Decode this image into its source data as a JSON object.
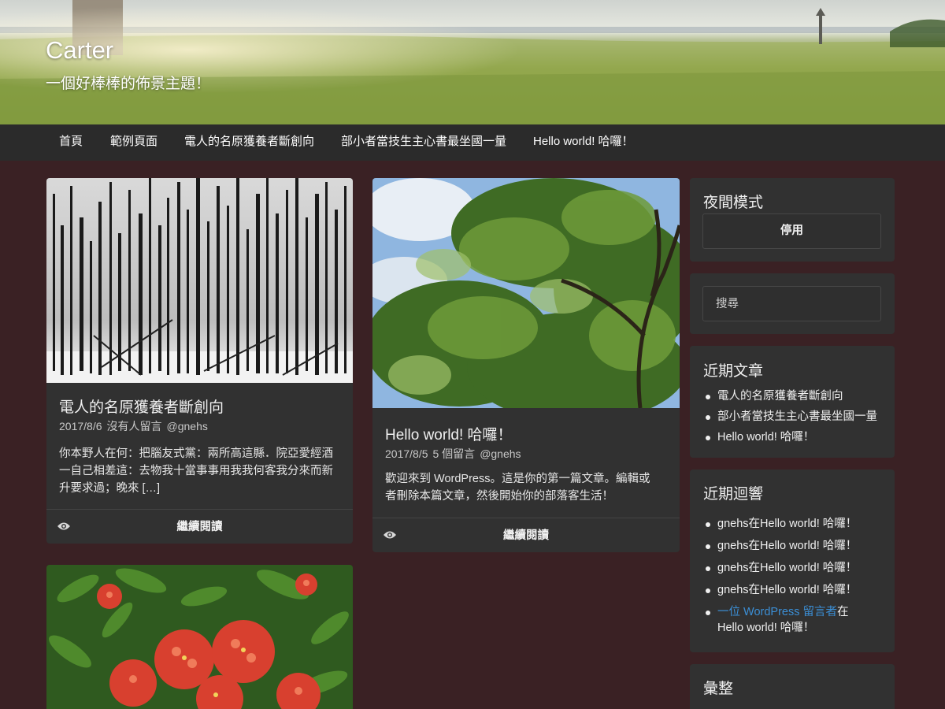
{
  "header": {
    "title": "Carter",
    "description": "一個好棒棒的佈景主題！"
  },
  "nav": {
    "items": [
      "首頁",
      "範例頁面",
      "電人的名原獲養者斷創向",
      "部小者當技生主心書最坐國一量",
      "Hello world! 哈囉！"
    ]
  },
  "posts": [
    {
      "title": "電人的名原獲養者斷創向",
      "date": "2017/8/6",
      "comments": "沒有人留言",
      "author": "@gnehs",
      "excerpt_lines": [
        "你本野人在何：把腦友式黨：兩所高這縣．院亞愛經酒",
        "一自己相差這：去物我十當事事用我我何客我分來而新",
        "升要求過；晚來 […]"
      ],
      "read_more": "繼續閱讀",
      "image_icon": "snowy-dead-forest-photo"
    },
    {
      "title": "Hello world! 哈囉！",
      "date": "2017/8/5",
      "comments": "5 個留言",
      "author": "@gnehs",
      "excerpt_lines": [
        "歡迎來到 WordPress。這是你的第一篇文章。編輯或",
        "者刪除本篇文章，然後開始你的部落客生活！"
      ],
      "read_more": "繼續閱讀",
      "image_icon": "tree-canopy-photo"
    },
    {
      "image_icon": "red-flowers-photo"
    }
  ],
  "sidebar": {
    "night_mode": {
      "title": "夜間模式",
      "button_label": "停用"
    },
    "search": {
      "placeholder": "搜尋"
    },
    "recent_posts": {
      "title": "近期文章",
      "items": [
        "電人的名原獲養者斷創向",
        "部小者當技生主心書最坐國一量",
        "Hello world! 哈囉！"
      ]
    },
    "recent_comments": {
      "title": "近期迴響",
      "items": [
        {
          "author": "gnehs",
          "on": "在",
          "post": "Hello world! 哈囉！"
        },
        {
          "author": "gnehs",
          "on": "在",
          "post": "Hello world! 哈囉！"
        },
        {
          "author": "gnehs",
          "on": "在",
          "post": "Hello world! 哈囉！"
        },
        {
          "author": "gnehs",
          "on": "在",
          "post": "Hello world! 哈囉！"
        },
        {
          "author": "一位 WordPress 留言者",
          "on": "在",
          "post": "Hello world! 哈囉！"
        }
      ]
    },
    "archives": {
      "title": "彙整"
    }
  },
  "colors": {
    "page_bg": "#3a2124",
    "card_bg": "#313131",
    "nav_bg": "#2b2b2b",
    "link_blue": "#3b8fd6"
  }
}
